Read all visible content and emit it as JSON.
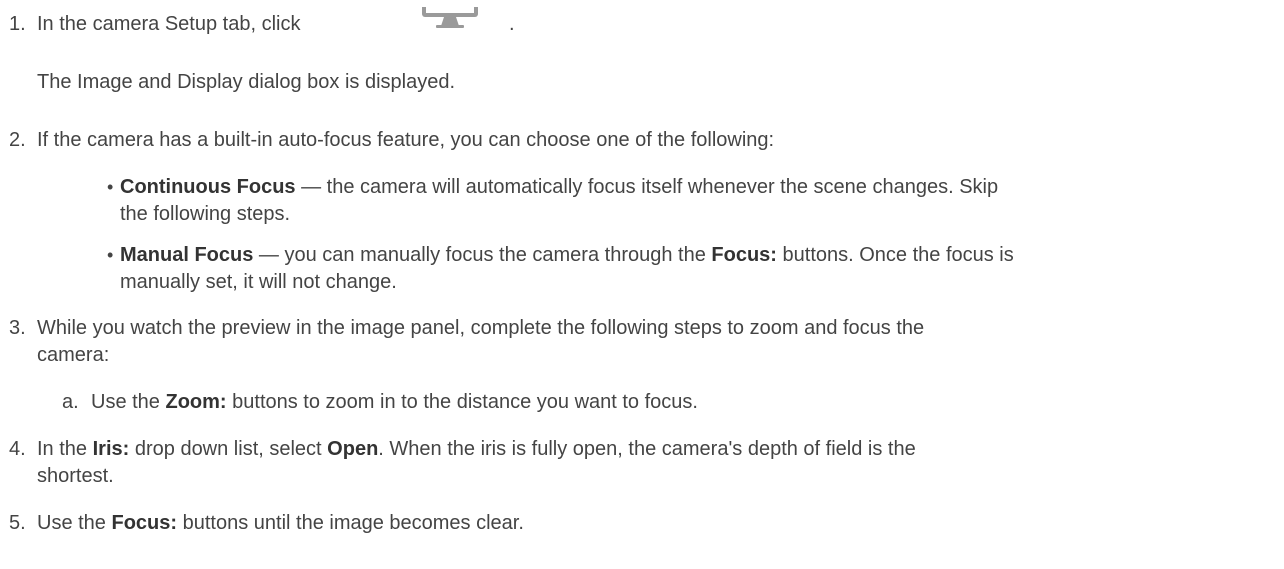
{
  "steps": [
    {
      "num": "1.",
      "text_before": "In the camera Setup tab, click",
      "icon": "monitor-icon",
      "text_after": ".",
      "result": "The Image and Display dialog box is displayed."
    },
    {
      "num": "2.",
      "text": "If the camera has a built-in auto-focus feature, you can choose one of the following:",
      "options": [
        {
          "label": "Continuous Focus",
          "desc_line1": " — the camera will automatically focus itself whenever the scene changes. Skip",
          "desc_line2": "the following steps."
        },
        {
          "label": "Manual Focus",
          "desc_line1a": " — you can manually focus the camera through the ",
          "desc_bold": "Focus:",
          "desc_line1b": " buttons. Once the focus is",
          "desc_line2": "manually set, it will not change."
        }
      ]
    },
    {
      "num": "3.",
      "line1": "While you watch the preview in the image panel, complete the following steps to zoom and focus the",
      "line2": "camera:",
      "substeps": [
        {
          "letter": "a.",
          "pre": "Use the ",
          "bold": "Zoom:",
          "post": " buttons to zoom in to the distance you want to focus."
        }
      ]
    },
    {
      "num": "4.",
      "pre": "In the ",
      "bold1": "Iris:",
      "mid": " drop down list, select ",
      "bold2": "Open",
      "post": ". When the iris is fully open, the camera's depth of field is the",
      "line2": "shortest."
    },
    {
      "num": "5.",
      "pre": "Use the ",
      "bold": "Focus:",
      "post": " buttons until the image becomes clear."
    }
  ]
}
